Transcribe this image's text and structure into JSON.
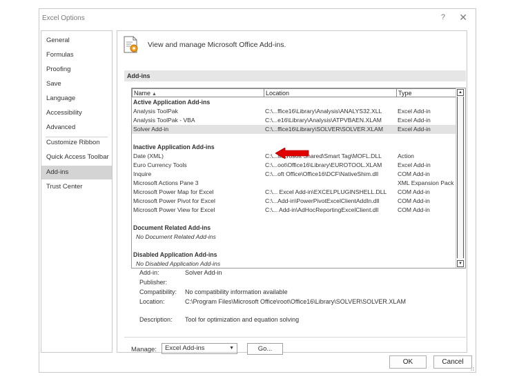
{
  "window": {
    "title": "Excel Options",
    "help": "?",
    "close": "✕"
  },
  "nav": [
    {
      "label": "General"
    },
    {
      "label": "Formulas"
    },
    {
      "label": "Proofing"
    },
    {
      "label": "Save"
    },
    {
      "label": "Language"
    },
    {
      "label": "Accessibility"
    },
    {
      "label": "Advanced"
    },
    {
      "label": "Customize Ribbon"
    },
    {
      "label": "Quick Access Toolbar"
    },
    {
      "label": "Add-ins",
      "selected": true
    },
    {
      "label": "Trust Center"
    }
  ],
  "header": {
    "text": "View and manage Microsoft Office Add-ins.",
    "icon": "add-ins-gear-icon"
  },
  "section_title": "Add-ins",
  "table": {
    "columns": {
      "name": "Name",
      "sort": "▲",
      "location": "Location",
      "type": "Type"
    },
    "groups": {
      "active": "Active Application Add-ins",
      "inactive": "Inactive Application Add-ins",
      "document": "Document Related Add-ins",
      "document_empty": "No Document Related Add-ins",
      "disabled": "Disabled Application Add-ins",
      "disabled_empty": "No Disabled Application Add-ins"
    },
    "active_rows": [
      {
        "name": "Analysis ToolPak",
        "location": "C:\\...ffice16\\Library\\Analysis\\ANALYS32.XLL",
        "type": "Excel Add-in"
      },
      {
        "name": "Analysis ToolPak - VBA",
        "location": "C:\\...e16\\Library\\Analysis\\ATPVBAEN.XLAM",
        "type": "Excel Add-in"
      },
      {
        "name": "Solver Add-in",
        "location": "C:\\...ffice16\\Library\\SOLVER\\SOLVER.XLAM",
        "type": "Excel Add-in"
      }
    ],
    "inactive_rows": [
      {
        "name": "Date (XML)",
        "location": "C:\\...Microsoft Shared\\Smart Tag\\MOFL.DLL",
        "type": "Action"
      },
      {
        "name": "Euro Currency Tools",
        "location": "C:\\...oot\\Office16\\Library\\EUROTOOL.XLAM",
        "type": "Excel Add-in"
      },
      {
        "name": "Inquire",
        "location": "C:\\...oft Office\\Office16\\DCF\\NativeShim.dll",
        "type": "COM Add-in"
      },
      {
        "name": "Microsoft Actions Pane 3",
        "location": "",
        "type": "XML Expansion Pack"
      },
      {
        "name": "Microsoft Power Map for Excel",
        "location": "C:\\... Excel Add-in\\EXCELPLUGINSHELL.DLL",
        "type": "COM Add-in"
      },
      {
        "name": "Microsoft Power Pivot for Excel",
        "location": "C:\\...Add-in\\PowerPivotExcelClientAddIn.dll",
        "type": "COM Add-in"
      },
      {
        "name": "Microsoft Power View for Excel",
        "location": "C:\\... Add-in\\AdHocReportingExcelClient.dll",
        "type": "COM Add-in"
      }
    ]
  },
  "details": {
    "addin_label": "Add-in:",
    "addin_value": "Solver Add-in",
    "publisher_label": "Publisher:",
    "publisher_value": "",
    "compat_label": "Compatibility:",
    "compat_value": "No compatibility information available",
    "location_label": "Location:",
    "location_value": "C:\\Program Files\\Microsoft Office\\root\\Office16\\Library\\SOLVER\\SOLVER.XLAM",
    "description_label": "Description:",
    "description_value": "Tool for optimization and equation solving"
  },
  "manage": {
    "label": "Manage:",
    "selected": "Excel Add-ins",
    "go": "Go..."
  },
  "buttons": {
    "ok": "OK",
    "cancel": "Cancel"
  },
  "colors": {
    "highlight_arrow": "#e00000",
    "selected_nav": "#d4d4d4",
    "section_bg": "#e6e6e6"
  }
}
